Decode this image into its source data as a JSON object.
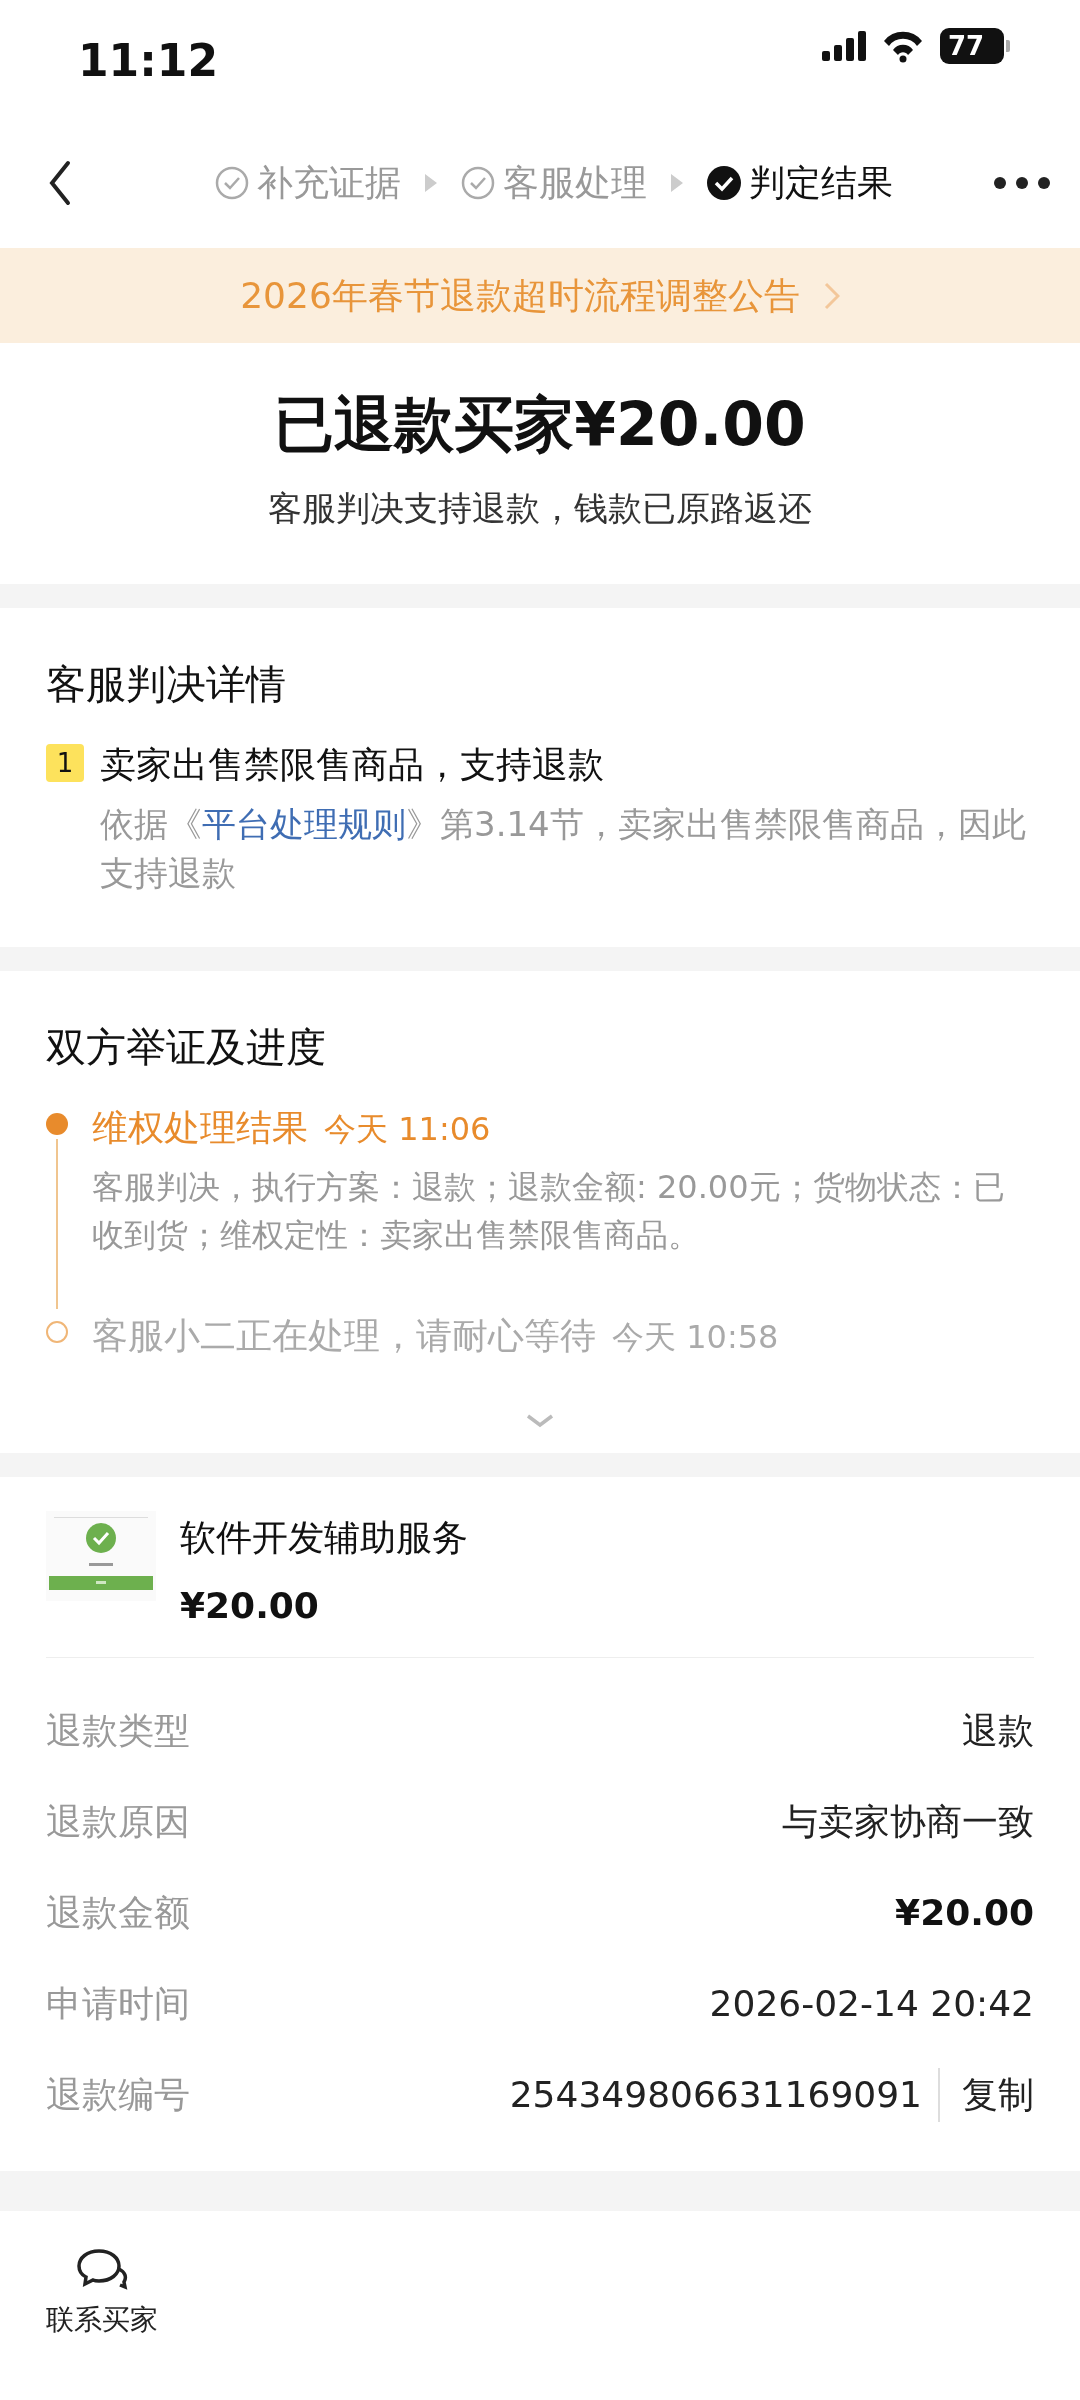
{
  "status_bar": {
    "time": "11:12",
    "battery": "77"
  },
  "steps": [
    {
      "label": "补充证据",
      "selected": false
    },
    {
      "label": "客服处理",
      "selected": false
    },
    {
      "label": "判定结果",
      "selected": true
    }
  ],
  "notice": {
    "text": "2026年春节退款超时流程调整公告"
  },
  "result": {
    "title": "已退款买家¥20.00",
    "subtitle": "客服判决支持退款，钱款已原路返还"
  },
  "judgment": {
    "title": "客服判决详情",
    "items": [
      {
        "number": "1",
        "title": "卖家出售禁限售商品，支持退款",
        "before": "依据《",
        "link": "平台处理规则",
        "after": "》第3.14节，卖家出售禁限售商品，因此支持退款"
      }
    ]
  },
  "progress": {
    "title": "双方举证及进度",
    "events": [
      {
        "title": "维权处理结果",
        "time": "今天 11:06",
        "detail": "客服判决，执行方案：退款；退款金额: 20.00元；货物状态：已收到货；维权定性：卖家出售禁限售商品。",
        "active": true
      },
      {
        "title": "客服小二正在处理，请耐心等待",
        "time": "今天 10:58",
        "active": false
      }
    ]
  },
  "product": {
    "kind": "picture",
    "name": "软件开发辅助服务",
    "price": "¥20.00"
  },
  "details": [
    {
      "label": "退款类型",
      "value": "退款",
      "kind": "plain"
    },
    {
      "label": "退款原因",
      "value": "与卖家协商一致",
      "kind": "plain"
    },
    {
      "label": "退款金额",
      "value": "¥20.00",
      "kind": "amount"
    },
    {
      "label": "申请时间",
      "value": "2026-02-14 20:42",
      "kind": "plain"
    },
    {
      "label": "退款编号",
      "value": "254349806631169091",
      "kind": "copy",
      "action": "复制"
    }
  ],
  "footer": {
    "contact": "联系买家"
  }
}
